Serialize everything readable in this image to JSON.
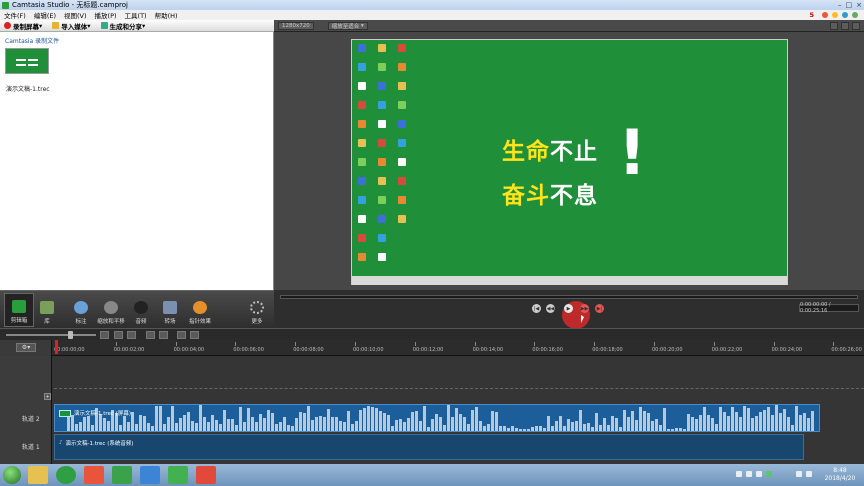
{
  "window": {
    "title": "Camtasia Studio - 无标题.camproj",
    "controls": [
      "–",
      "□",
      "×"
    ]
  },
  "menu": {
    "items": [
      "文件(F)",
      "编辑(E)",
      "视图(V)",
      "播放(P)",
      "工具(T)",
      "帮助(H)"
    ],
    "badge": "5"
  },
  "toolbar": {
    "record": "录制屏幕",
    "import": "导入媒体",
    "produce": "生成和分享"
  },
  "clipbin": {
    "label": "Camtasia 录制文件",
    "file": "演示文稿-1.trec"
  },
  "preview": {
    "resolution": "1280x720",
    "fit": "缩放至适合"
  },
  "canvas": {
    "line1_a": "生命",
    "line1_b": "不止",
    "line2_a": "奋斗",
    "line2_b": "不息",
    "mark": "!"
  },
  "player": {
    "timecode": "0:00:00:00 / 0:00:25:16",
    "prev": "|◀",
    "rew": "◀◀",
    "play": "▶",
    "ff": "▶▶",
    "next": "▶|"
  },
  "tabs": [
    "剪辑箱",
    "库",
    "标注",
    "缩放和平移",
    "音频",
    "转场",
    "指针效果",
    "更多"
  ],
  "timeline": {
    "gear": "⚙",
    "ticks": [
      "00:00:00;00",
      "00:00:02;00",
      "00:00:04;00",
      "00:00:06;00",
      "00:00:08;00",
      "00:00:10;00",
      "00:00:12;00",
      "00:00:14;00",
      "00:00:16;00",
      "00:00:18;00",
      "00:00:20;00",
      "00:00:22;00",
      "00:00:24;00",
      "00:00:26;00"
    ],
    "tracks": [
      {
        "name": "轨道 2",
        "clip": "演示文稿-1.trec (屏幕)"
      },
      {
        "name": "轨道 1",
        "clip": "演示文稿-1.trec (系统音频)"
      }
    ],
    "add": "+"
  },
  "taskbar": {
    "time": "8:48",
    "date": "2018/4/20"
  },
  "colors": {
    "canvas_green": "#1f8f3a",
    "accent_yellow": "#ffe419",
    "play_red": "#d72828",
    "clip_blue": "#1b5e99"
  }
}
